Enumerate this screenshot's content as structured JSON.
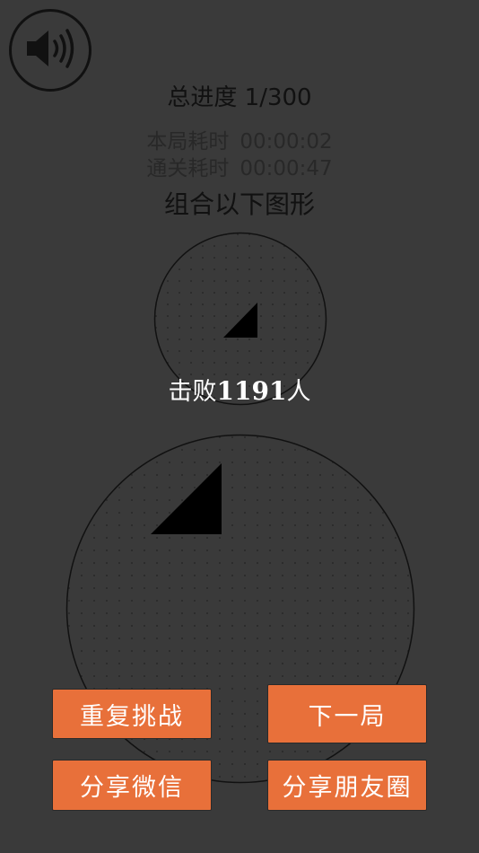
{
  "sound": {
    "icon": "speaker-icon"
  },
  "progress": {
    "label": "总进度",
    "value": "1/300"
  },
  "timers": {
    "round_label": "本局耗时",
    "round_value": "00:00:02",
    "total_label": "通关耗时",
    "total_value": "00:00:47"
  },
  "instruction": "组合以下图形",
  "result": {
    "prefix": "击败",
    "count": "1191",
    "suffix": "人"
  },
  "buttons": {
    "retry": "重复挑战",
    "next": "下一局",
    "share_wechat": "分享微信",
    "share_moments": "分享朋友圈"
  },
  "colors": {
    "background": "#3a3a3a",
    "button": "#e8703a",
    "shape": "#000000"
  }
}
